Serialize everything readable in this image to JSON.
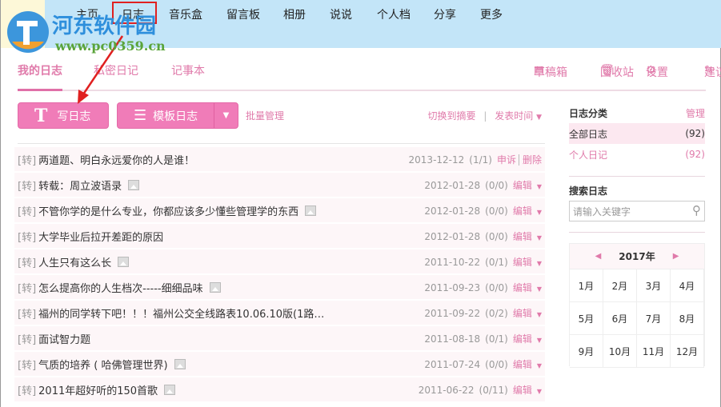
{
  "nav": [
    "主页",
    "日志",
    "音乐盒",
    "留言板",
    "相册",
    "说说",
    "个人档",
    "分享",
    "更多"
  ],
  "watermark": {
    "name": "河东软件园",
    "url": "www.pc0359.cn"
  },
  "tabs": [
    "我的日志",
    "私密日记",
    "记事本"
  ],
  "tools": [
    "草稿箱",
    "回收站",
    "设置",
    "建议"
  ],
  "buttons": {
    "write": "写日志",
    "template": "模板日志",
    "batch": "批量管理"
  },
  "sort": {
    "switch": "切换到摘要",
    "sep": "|",
    "order": "发表时间"
  },
  "posts": [
    {
      "tag": "[转]",
      "title": "两道题、明白永远爱你的人是谁！",
      "img": false,
      "date": "2013-12-12",
      "count": "(1/1)",
      "actions": [
        "申诉",
        "删除"
      ]
    },
    {
      "tag": "[转]",
      "title": "转载：周立波语录",
      "img": true,
      "date": "2012-01-28",
      "count": "(0/0)",
      "actions": [
        "编辑"
      ]
    },
    {
      "tag": "[转]",
      "title": "不管你学的是什么专业，你都应该多少懂些管理学的东西",
      "img": true,
      "date": "2012-01-28",
      "count": "(0/0)",
      "actions": [
        "编辑"
      ]
    },
    {
      "tag": "[转]",
      "title": "大学毕业后拉开差距的原因",
      "img": false,
      "date": "2012-01-28",
      "count": "(0/0)",
      "actions": [
        "编辑"
      ]
    },
    {
      "tag": "[转]",
      "title": "人生只有这么长",
      "img": true,
      "date": "2011-10-22",
      "count": "(0/1)",
      "actions": [
        "编辑"
      ]
    },
    {
      "tag": "[转]",
      "title": "怎么提高你的人生档次-----细细品味",
      "img": true,
      "date": "2011-09-23",
      "count": "(0/0)",
      "actions": [
        "编辑"
      ]
    },
    {
      "tag": "[转]",
      "title": "福州的同学转下吧！！！福州公交全线路表10.06.10版(1路…",
      "img": false,
      "date": "2011-09-22",
      "count": "(0/2)",
      "actions": [
        "编辑"
      ]
    },
    {
      "tag": "[转]",
      "title": "面试智力题",
      "img": false,
      "date": "2011-08-18",
      "count": "(0/1)",
      "actions": [
        "编辑"
      ]
    },
    {
      "tag": "[转]",
      "title": "气质的培养 ( 哈佛管理世界)",
      "img": true,
      "date": "2011-07-24",
      "count": "(0/0)",
      "actions": [
        "编辑"
      ]
    },
    {
      "tag": "[转]",
      "title": "2011年超好听的150首歌",
      "img": true,
      "date": "2011-06-22",
      "count": "(0/11)",
      "actions": [
        "编辑"
      ]
    }
  ],
  "sidebar": {
    "cat_title": "日志分类",
    "manage": "管理",
    "cats": [
      {
        "name": "全部日志",
        "count": "(92)"
      },
      {
        "name": "个人日记",
        "count": "(92)"
      }
    ],
    "search_title": "搜索日志",
    "search_placeholder": "请输入关键字",
    "year": "2017年",
    "months": [
      "1月",
      "2月",
      "3月",
      "4月",
      "5月",
      "6月",
      "7月",
      "8月",
      "9月",
      "10月",
      "11月",
      "12月"
    ]
  },
  "colors": {
    "accent": "#e07aaa",
    "button": "#f07cb8",
    "header": "#c3e5f8"
  }
}
